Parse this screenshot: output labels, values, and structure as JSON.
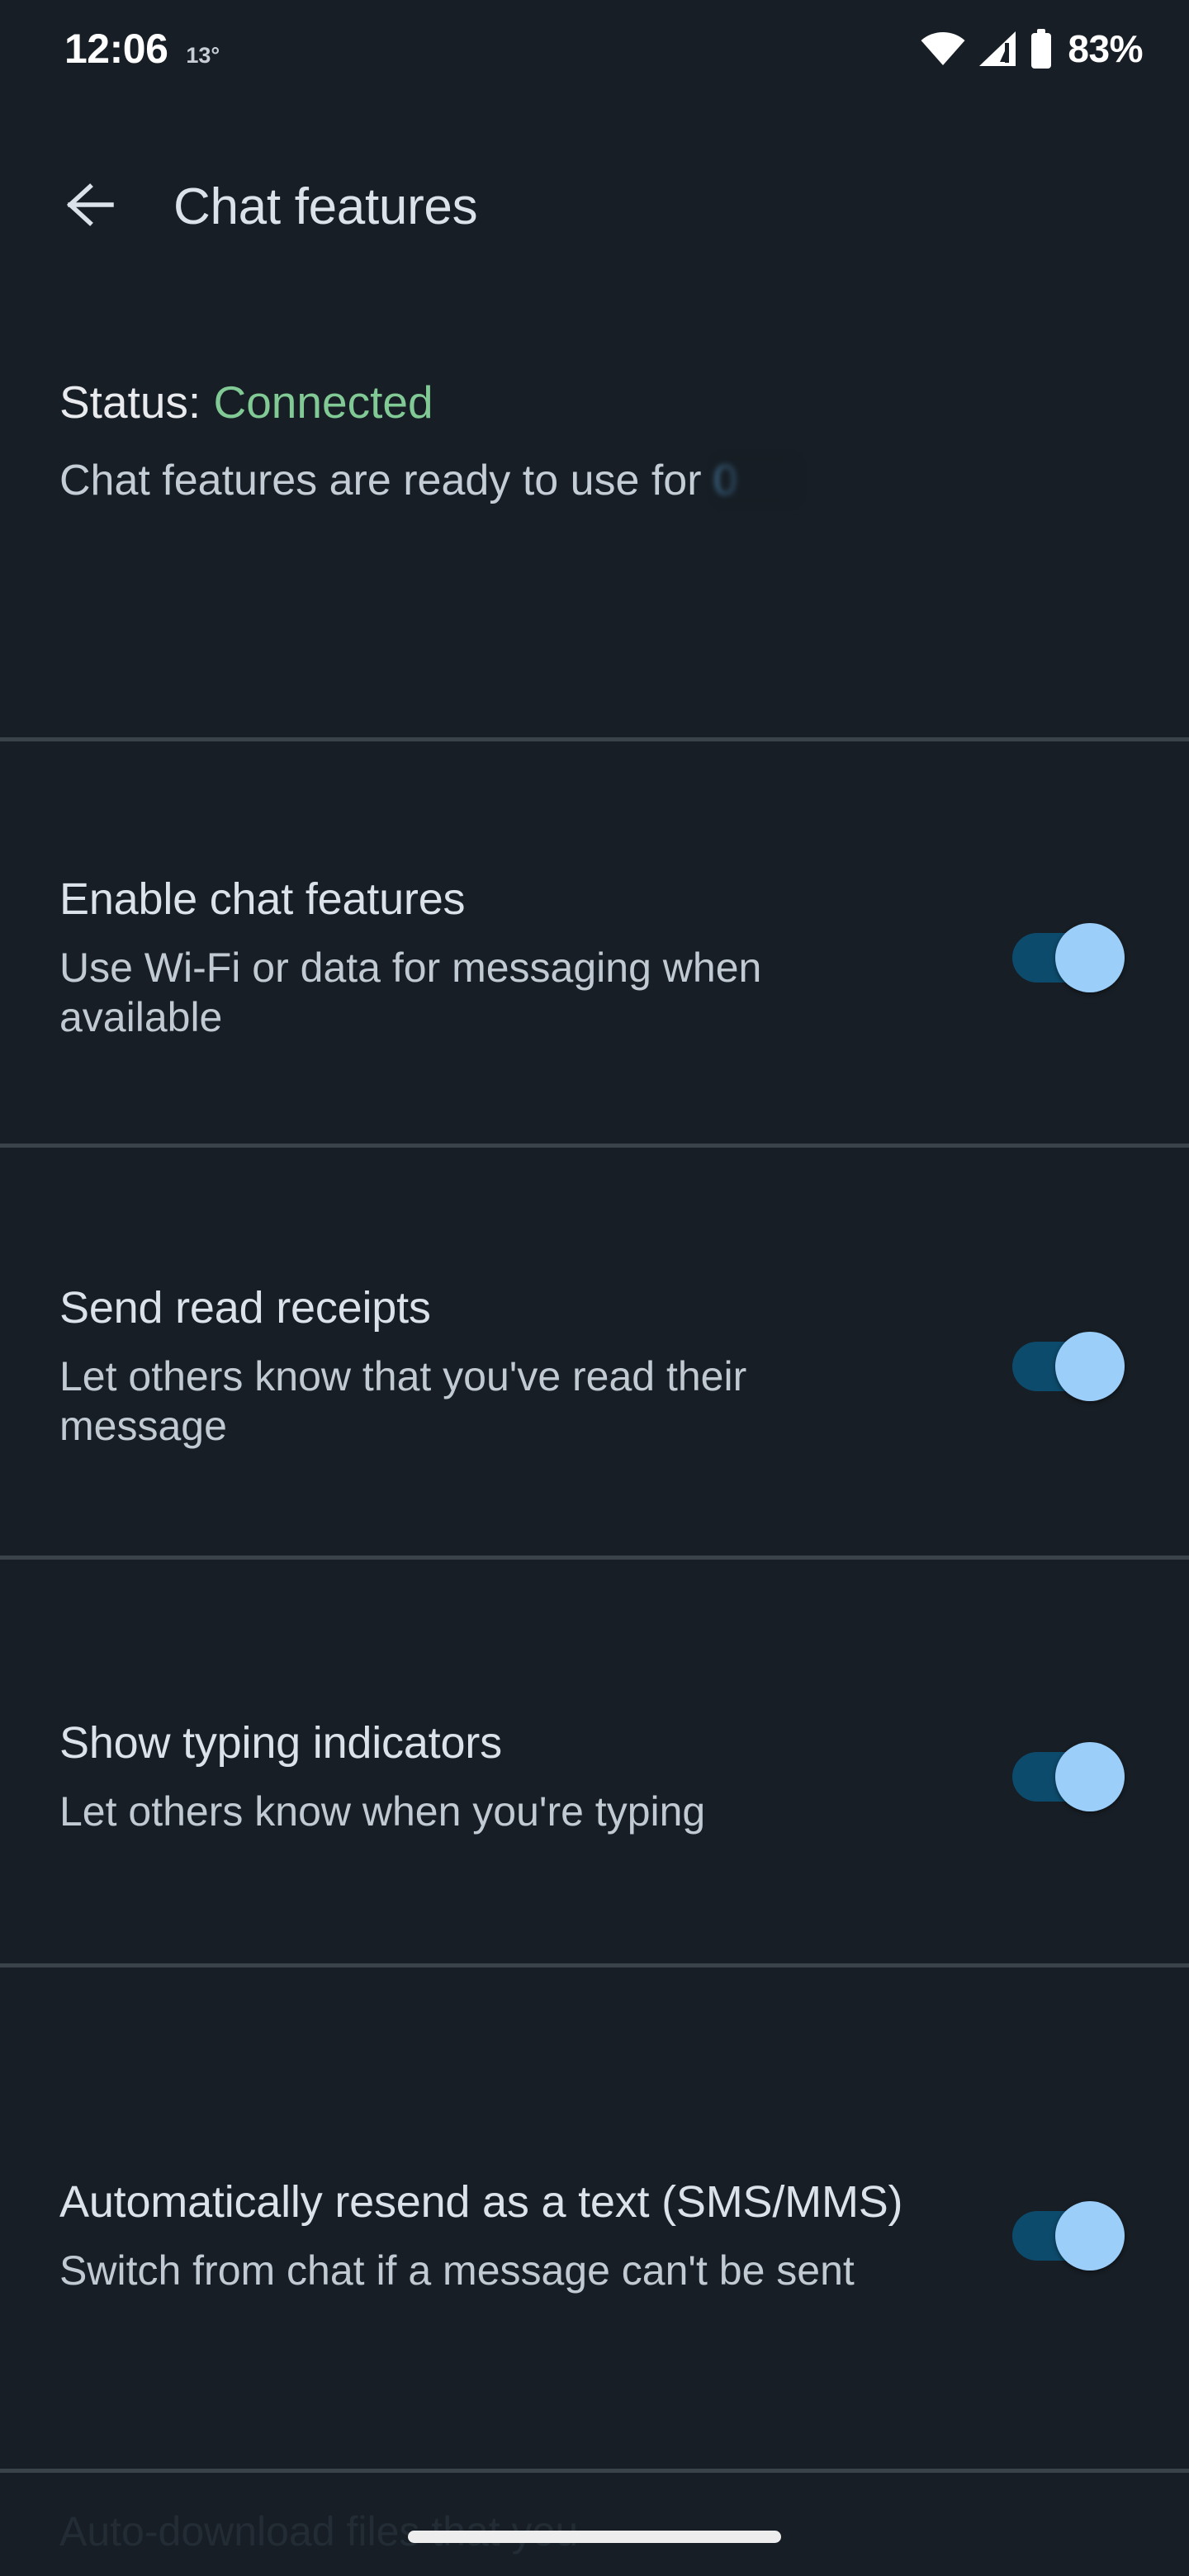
{
  "statusbar": {
    "time": "12:06",
    "temperature": "13°",
    "battery_percent": "83%",
    "icons": [
      "wifi-icon",
      "cellular-signal-icon",
      "battery-icon"
    ]
  },
  "appbar": {
    "back_label": "Back",
    "title": "Chat features"
  },
  "status_section": {
    "label": "Status:",
    "value": "Connected",
    "value_color": "#81c995",
    "description_prefix": "Chat features are ready to use for ",
    "description_redacted": "0      "
  },
  "settings": [
    {
      "title": "Enable chat features",
      "subtitle": "Use Wi-Fi or data for messaging when available",
      "toggle_on": true
    },
    {
      "title": "Send read receipts",
      "subtitle": "Let others know that you've read their message",
      "toggle_on": true
    },
    {
      "title": "Show typing indicators",
      "subtitle": "Let others know when you're typing",
      "toggle_on": true
    },
    {
      "title": "Automatically resend as a text (SMS/MMS)",
      "subtitle": "Switch from chat if a message can't be sent",
      "toggle_on": true
    }
  ],
  "next_section_preview": {
    "text": "Auto-download files that you"
  },
  "colors": {
    "background": "#171e25",
    "divider": "#3b434a",
    "title_text": "#dbe2ea",
    "subtitle_text": "#c1c9d2",
    "accent_connected": "#81c995",
    "toggle_track_on": "#0d4b6c",
    "toggle_thumb_on": "#9ccefa",
    "gesture_bar": "#ededed"
  }
}
